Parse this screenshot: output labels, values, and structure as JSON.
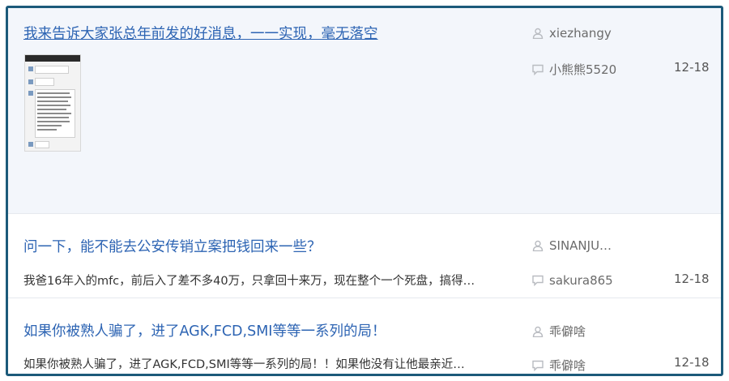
{
  "threads": [
    {
      "title": "我来告诉大家张总年前发的好消息，一一实现，毫无落空",
      "excerpt": "",
      "author": "xiezhangy",
      "last_replier": "小熊熊5520",
      "date": "12-18"
    },
    {
      "title": "问一下，能不能去公安传销立案把钱回来一些？",
      "excerpt": "我爸16年入的mfc，前后入了差不多40万，只拿回十来万，现在整个一个死盘，搞得…",
      "author": "SINANJU…",
      "last_replier": "sakura865",
      "date": "12-18"
    },
    {
      "title": "如果你被熟人骗了，进了AGK,FCD,SMI等等一系列的局！",
      "excerpt": "如果你被熟人骗了，进了AGK,FCD,SMI等等一系列的局！！如果他没有让他最亲近…",
      "author": "乖僻啥",
      "last_replier": "乖僻啥",
      "date": "12-18"
    }
  ],
  "icons": {
    "author": "user-icon",
    "reply": "comment-icon"
  },
  "colors": {
    "title_link": "#2d64b3",
    "frame_border": "#1c5a7a",
    "highlight_bg": "#f3f6fb",
    "meta_text": "#6b6b6b"
  }
}
